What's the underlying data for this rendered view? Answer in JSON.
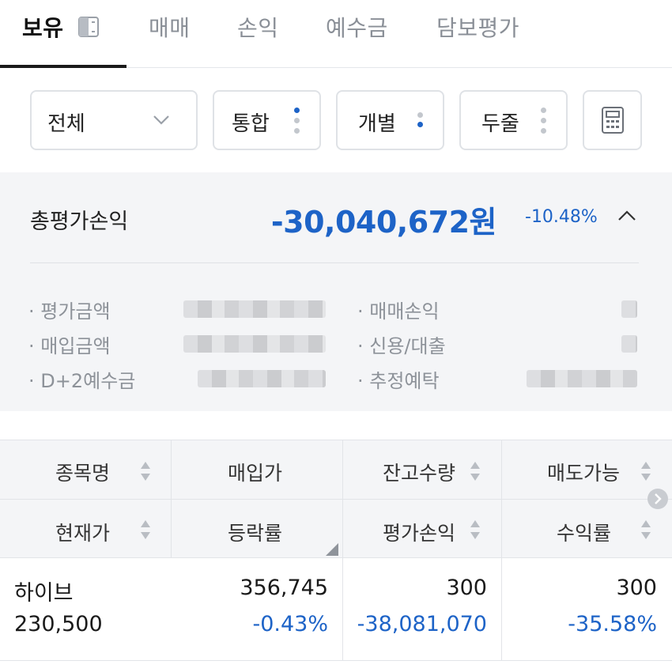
{
  "tabs": [
    {
      "label": "보유",
      "active": true
    },
    {
      "label": "매매"
    },
    {
      "label": "손익"
    },
    {
      "label": "예수금"
    },
    {
      "label": "담보평가"
    }
  ],
  "filters": {
    "scope": {
      "selected": "전체"
    },
    "options": [
      "통합",
      "개별",
      "두줄"
    ]
  },
  "summary": {
    "title": "총평가손익",
    "value": "-30,040,672원",
    "rate": "-10.48%",
    "left_rows": [
      "· 평가금액",
      "· 매입금액",
      "· D+2예수금"
    ],
    "right_rows": [
      "· 매매손익",
      "· 신용/대출",
      "· 추정예탁"
    ]
  },
  "table": {
    "headers_row1": [
      "종목명",
      "매입가",
      "잔고수량",
      "매도가능"
    ],
    "headers_row2": [
      "현재가",
      "등락률",
      "평가손익",
      "수익률"
    ],
    "rows": [
      {
        "name": "하이브",
        "price": "230,500",
        "buy_price": "356,745",
        "change_rate": "-0.43%",
        "qty": "300",
        "eval_pl": "-38,081,070",
        "sellable": "300",
        "return_rate": "-35.58%"
      }
    ]
  },
  "colors": {
    "accent": "#1d63c7",
    "text": "#222222",
    "muted": "#8a8f97",
    "panel": "#f4f5f7"
  },
  "icons": [
    "split-view-icon",
    "chevron-down-icon",
    "more-vertical-icon",
    "calculator-icon",
    "chevron-up-icon",
    "sort-icon",
    "scroll-right-icon",
    "resize-corner-icon"
  ]
}
